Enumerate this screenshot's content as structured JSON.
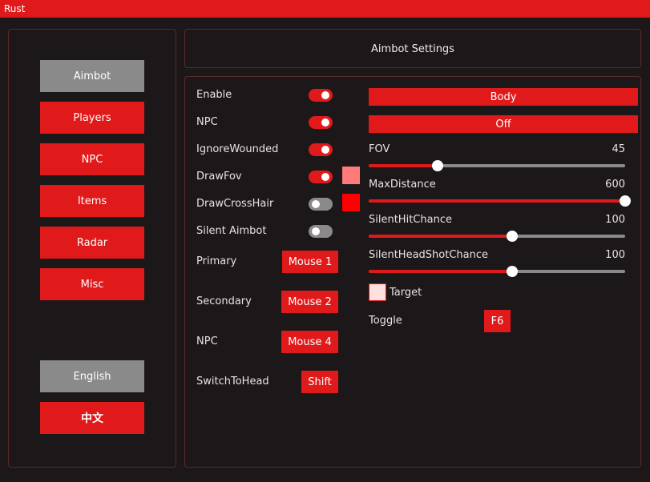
{
  "window": {
    "title": "Rust"
  },
  "sidebar": {
    "items": [
      {
        "label": "Aimbot",
        "active": true
      },
      {
        "label": "Players",
        "active": false
      },
      {
        "label": "NPC",
        "active": false
      },
      {
        "label": "Items",
        "active": false
      },
      {
        "label": "Radar",
        "active": false
      },
      {
        "label": "Misc",
        "active": false
      }
    ],
    "languages": [
      {
        "label": "English",
        "active": true
      },
      {
        "label": "中文",
        "active": false
      }
    ]
  },
  "header": {
    "title": "Aimbot Settings"
  },
  "options": {
    "enable": {
      "label": "Enable",
      "on": true
    },
    "npc": {
      "label": "NPC",
      "on": true
    },
    "ignore_wounded": {
      "label": "IgnoreWounded",
      "on": true
    },
    "draw_fov": {
      "label": "DrawFov",
      "on": true,
      "color": "#ff7a7a"
    },
    "draw_crosshair": {
      "label": "DrawCrossHair",
      "on": false,
      "color": "#ff0000"
    },
    "silent_aimbot": {
      "label": "Silent Aimbot",
      "on": false
    }
  },
  "keybinds": {
    "primary": {
      "label": "Primary",
      "key": "Mouse 1"
    },
    "secondary": {
      "label": "Secondary",
      "key": "Mouse 2"
    },
    "npc": {
      "label": "NPC",
      "key": "Mouse 4"
    },
    "switch_to_head": {
      "label": "SwitchToHead",
      "key": "Shift"
    }
  },
  "right": {
    "bone_select": "Body",
    "mode_select": "Off",
    "sliders": [
      {
        "label": "FOV",
        "value": 45,
        "fraction": 0.27
      },
      {
        "label": "MaxDistance",
        "value": 600,
        "fraction": 1.0
      },
      {
        "label": "SilentHitChance",
        "value": 100,
        "fraction": 0.56
      },
      {
        "label": "SilentHeadShotChance",
        "value": 100,
        "fraction": 0.56
      }
    ],
    "target": {
      "label": "Target"
    },
    "toggle": {
      "label": "Toggle",
      "key": "F6"
    }
  },
  "colors": {
    "accent": "#e01a1a",
    "inactive": "#8a8a8a",
    "background": "#1c1819",
    "border": "#5a2a28"
  }
}
